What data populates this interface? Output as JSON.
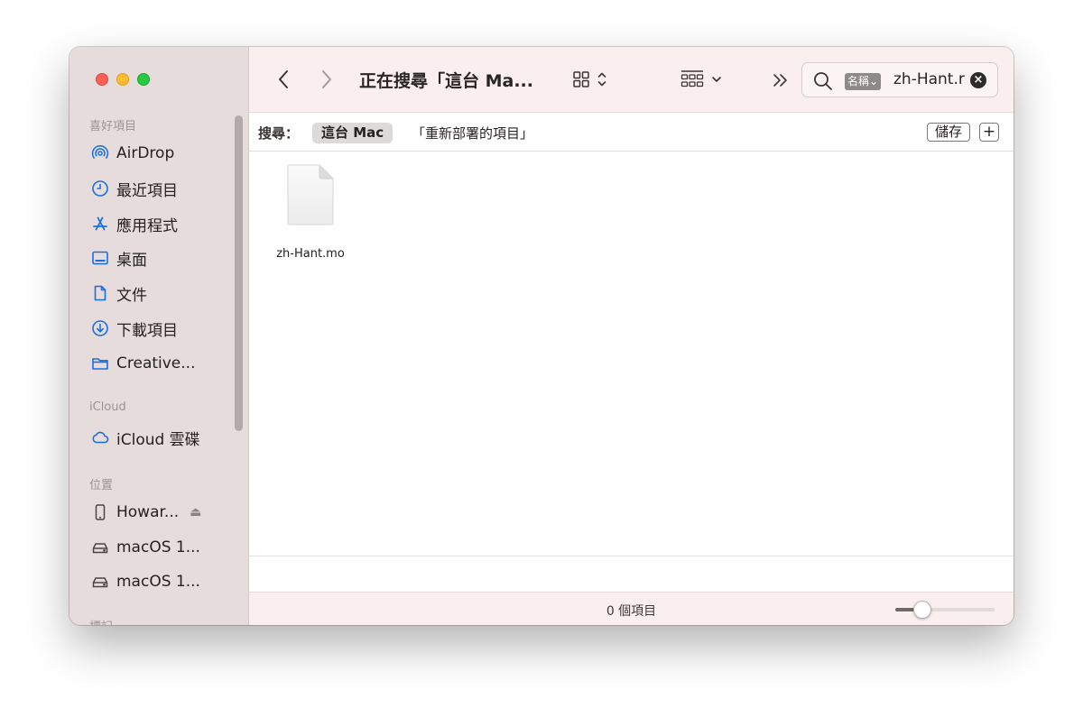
{
  "window": {
    "title": "正在搜尋「這台 Ma..."
  },
  "sidebar": {
    "favorites_header": "喜好項目",
    "favorites": [
      {
        "label": "AirDrop",
        "icon": "airdrop-icon"
      },
      {
        "label": "最近項目",
        "icon": "clock-icon"
      },
      {
        "label": "應用程式",
        "icon": "applications-icon"
      },
      {
        "label": "桌面",
        "icon": "desktop-icon"
      },
      {
        "label": "文件",
        "icon": "document-icon"
      },
      {
        "label": "下載項目",
        "icon": "download-icon"
      },
      {
        "label": "Creative...",
        "icon": "folder-icon"
      }
    ],
    "icloud_header": "iCloud",
    "icloud": [
      {
        "label": "iCloud 雲碟",
        "icon": "cloud-icon"
      }
    ],
    "locations_header": "位置",
    "locations": [
      {
        "label": "Howar...",
        "icon": "iphone-icon"
      },
      {
        "label": "macOS 1...",
        "icon": "disk-icon"
      },
      {
        "label": "macOS 1...",
        "icon": "disk-icon"
      }
    ],
    "tags_header": "標記"
  },
  "search": {
    "token": "名稱⌄",
    "query": "zh-Hant.r"
  },
  "scope_bar": {
    "label": "搜尋：",
    "selected": "這台 Mac",
    "option": "「重新部署的項目」",
    "save_label": "儲存",
    "add_label": "+"
  },
  "results": [
    {
      "name": "zh-Hant.mo",
      "icon": "generic-file-icon"
    }
  ],
  "status": {
    "count_text": "0 個項目",
    "icon_size_level": 0.27
  },
  "colors": {
    "sidebar_bg": "#e6dcdc",
    "toolbar_bg": "#fbeeee",
    "accent_blue": "#1a6fe0",
    "close": "#ff5f57",
    "minimize": "#febc2e",
    "zoom": "#28c840"
  }
}
